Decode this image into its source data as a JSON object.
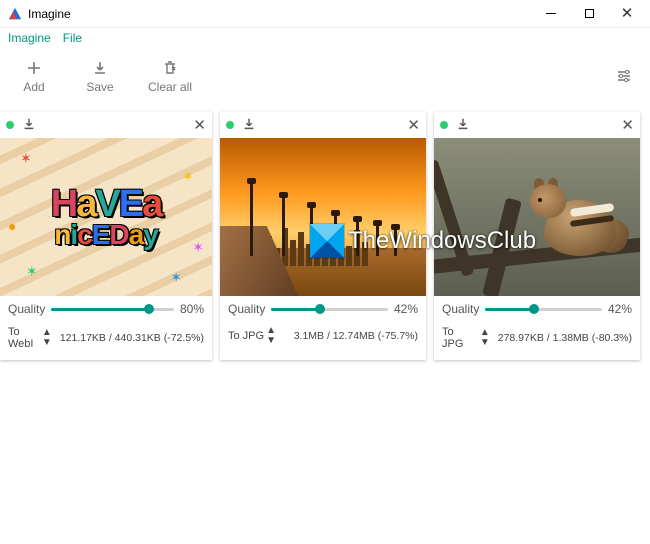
{
  "app": {
    "title": "Imagine"
  },
  "menu": {
    "imagine": "Imagine",
    "file": "File"
  },
  "toolbar": {
    "add": "Add",
    "save": "Save",
    "clear_all": "Clear all"
  },
  "cards": [
    {
      "quality_label": "Quality",
      "quality_value": "80%",
      "quality_pct": 80,
      "format": "To WebI",
      "sizes": "121.17KB / 440.31KB (-72.5%)"
    },
    {
      "quality_label": "Quality",
      "quality_value": "42%",
      "quality_pct": 42,
      "format": "To JPG",
      "sizes": "3.1MB / 12.74MB (-75.7%)"
    },
    {
      "quality_label": "Quality",
      "quality_value": "42%",
      "quality_pct": 42,
      "format": "To JPG",
      "sizes": "278.97KB / 1.38MB (-80.3%)"
    }
  ],
  "watermark": "TheWindowsClub"
}
